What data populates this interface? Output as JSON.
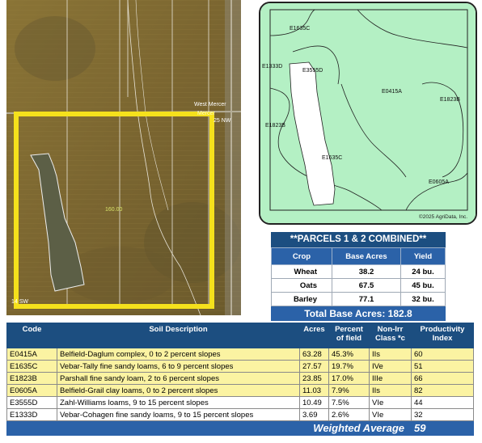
{
  "aerial": {
    "road_label": "West Mercer",
    "road_label_2": "Mercer",
    "road_code": "25 NW",
    "acres_label": "160.00",
    "section_label": "14 SW",
    "outline_color": "#f5e11c"
  },
  "soil_map": {
    "labels": [
      "E1635C",
      "E1333D",
      "E3555D",
      "E0415A",
      "E1823B",
      "E1823B",
      "E1635C",
      "E0605A"
    ],
    "copyright": "©2025 AgriData, Inc.",
    "fill_color": "#b4f0c4"
  },
  "parcels": {
    "title": "**PARCELS 1 & 2 COMBINED**",
    "headers": [
      "Crop",
      "Base Acres",
      "Yield"
    ],
    "rows": [
      [
        "Wheat",
        "38.2",
        "24 bu."
      ],
      [
        "Oats",
        "67.5",
        "45 bu."
      ],
      [
        "Barley",
        "77.1",
        "32 bu."
      ]
    ],
    "total_label": "Total Base Acres:",
    "total_value": "182.8"
  },
  "soil_table": {
    "headers": [
      "Code",
      "Soil Description",
      "Acres",
      "Percent of field",
      "Non-Irr Class *c",
      "Productivity Index"
    ],
    "rows": [
      [
        "E0415A",
        "Belfield-Daglum complex, 0 to 2 percent slopes",
        "63.28",
        "45.3%",
        "IIs",
        "60"
      ],
      [
        "E1635C",
        "Vebar-Tally fine sandy loams, 6 to 9 percent slopes",
        "27.57",
        "19.7%",
        "IVe",
        "51"
      ],
      [
        "E1823B",
        "Parshall fine sandy loam, 2 to 6 percent slopes",
        "23.85",
        "17.0%",
        "IIIe",
        "66"
      ],
      [
        "E0605A",
        "Belfield-Grail clay loams, 0 to 2 percent slopes",
        "11.03",
        "7.9%",
        "IIs",
        "82"
      ],
      [
        "E3555D",
        "Zahl-Williams loams, 9 to 15 percent slopes",
        "10.49",
        "7.5%",
        "VIe",
        "44"
      ],
      [
        "E1333D",
        "Vebar-Cohagen fine sandy loams, 9 to 15 percent slopes",
        "3.69",
        "2.6%",
        "VIe",
        "32"
      ]
    ],
    "highlighted_rows": [
      0,
      1,
      2,
      3
    ],
    "avg_label": "Weighted Average",
    "avg_value": "59",
    "highlight_color": "#fbf3a2",
    "header_color": "#1c4e80"
  }
}
